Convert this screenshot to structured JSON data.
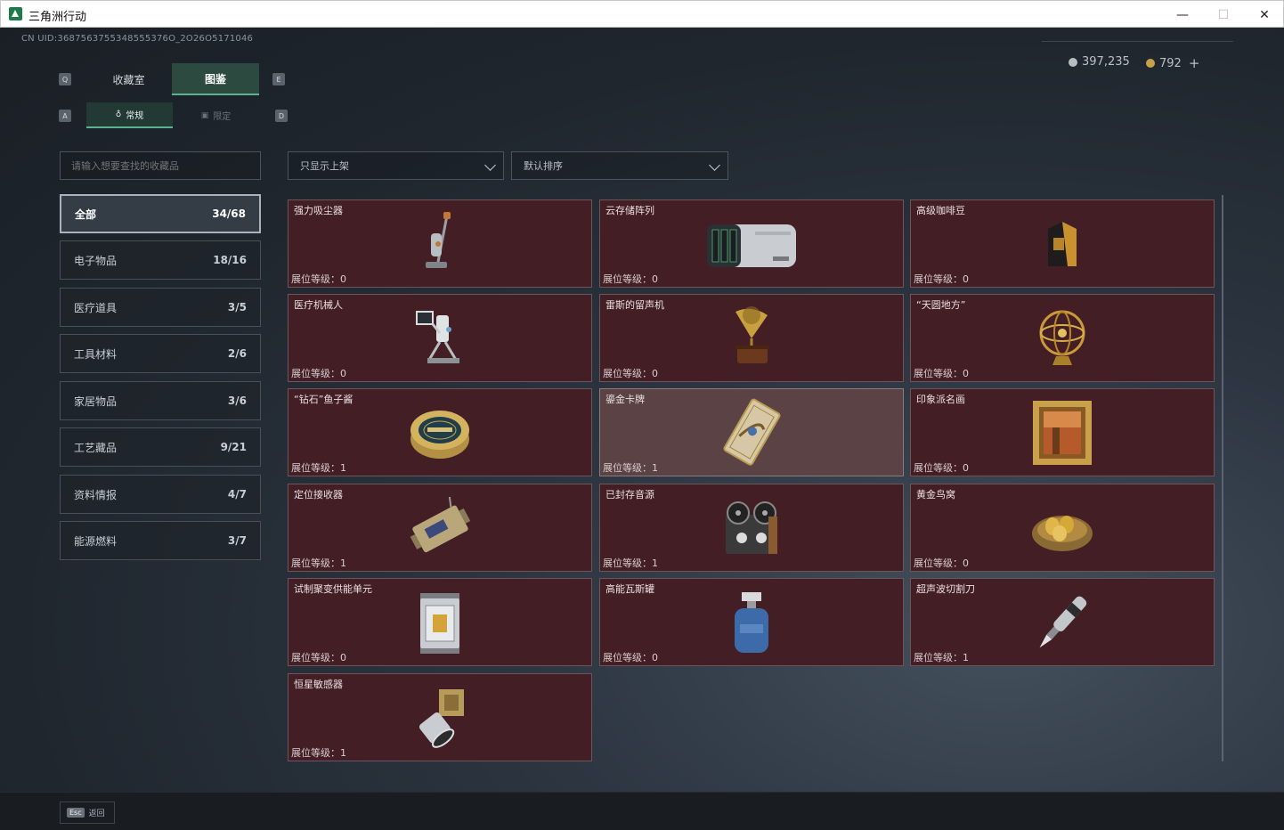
{
  "window": {
    "title": "三角洲行动"
  },
  "header": {
    "uid": "CN UID:3687563755348555376O_2O26O5171046",
    "currency": {
      "silver": "397,235",
      "gold": "792",
      "add": "+"
    }
  },
  "keys": {
    "main_left": "Q",
    "main_right": "E",
    "sub_left": "A",
    "sub_right": "D"
  },
  "tabs": [
    {
      "label": "收藏室"
    },
    {
      "label": "图鉴"
    }
  ],
  "subtabs": [
    {
      "label": "常规"
    },
    {
      "label": "限定"
    }
  ],
  "search": {
    "placeholder": "请输入想要查找的收藏品"
  },
  "filters": {
    "shelf": "只显示上架",
    "sort": "默认排序"
  },
  "categories": [
    {
      "label": "全部",
      "count": "34/68"
    },
    {
      "label": "电子物品",
      "count": "18/16"
    },
    {
      "label": "医疗道具",
      "count": "3/5"
    },
    {
      "label": "工具材料",
      "count": "2/6"
    },
    {
      "label": "家居物品",
      "count": "3/6"
    },
    {
      "label": "工艺藏品",
      "count": "9/21"
    },
    {
      "label": "资料情报",
      "count": "4/7"
    },
    {
      "label": "能源燃料",
      "count": "3/7"
    }
  ],
  "items": [
    {
      "name": "强力吸尘器",
      "level": "展位等级：0",
      "icon": "vacuum-icon"
    },
    {
      "name": "云存储阵列",
      "level": "展位等级：0",
      "icon": "server-array-icon"
    },
    {
      "name": "高级咖啡豆",
      "level": "展位等级：0",
      "icon": "coffee-bag-icon"
    },
    {
      "name": "医疗机械人",
      "level": "展位等级：0",
      "icon": "medical-robot-icon"
    },
    {
      "name": "雷斯的留声机",
      "level": "展位等级：0",
      "icon": "gramophone-icon"
    },
    {
      "name": "“天圆地方”",
      "level": "展位等级：0",
      "icon": "armillary-sphere-icon"
    },
    {
      "name": "“钻石”鱼子酱",
      "level": "展位等级：1",
      "icon": "caviar-tin-icon"
    },
    {
      "name": "鎏金卡牌",
      "level": "展位等级：1",
      "icon": "gilded-card-icon"
    },
    {
      "name": "印象派名画",
      "level": "展位等级：0",
      "icon": "framed-painting-icon"
    },
    {
      "name": "定位接收器",
      "level": "展位等级：1",
      "icon": "locator-receiver-icon"
    },
    {
      "name": "已封存音源",
      "level": "展位等级：1",
      "icon": "reel-recorder-icon"
    },
    {
      "name": "黄金鸟窝",
      "level": "展位等级：0",
      "icon": "golden-nest-icon"
    },
    {
      "name": "试制聚变供能单元",
      "level": "展位等级：0",
      "icon": "fusion-cell-icon"
    },
    {
      "name": "高能瓦斯罐",
      "level": "展位等级：0",
      "icon": "gas-canister-icon"
    },
    {
      "name": "超声波切割刀",
      "level": "展位等级：1",
      "icon": "ultrasonic-cutter-icon"
    },
    {
      "name": "恒星敏感器",
      "level": "展位等级：1",
      "icon": "star-sensor-icon"
    }
  ],
  "footer": {
    "esc_key": "Esc",
    "back": "返回"
  }
}
